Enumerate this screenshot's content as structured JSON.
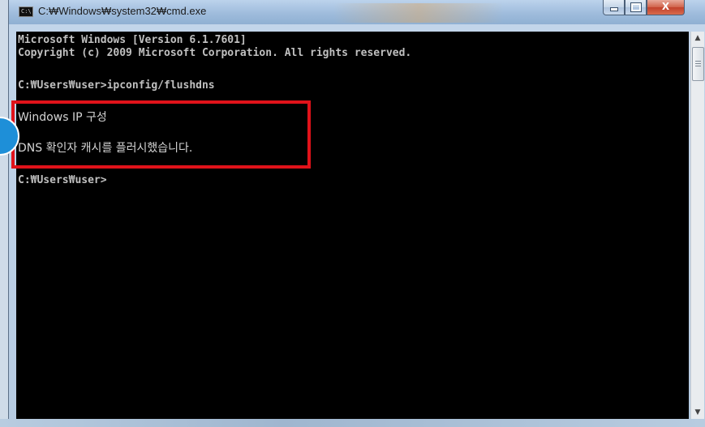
{
  "window": {
    "title": "C:₩Windows₩system32₩cmd.exe",
    "icon_label": "C:\\"
  },
  "controls": {
    "minimize_icon": "minimize-icon",
    "maximize_icon": "maximize-icon",
    "close_label": "X"
  },
  "console": {
    "lines": [
      "Microsoft Windows [Version 6.1.7601]",
      "Copyright (c) 2009 Microsoft Corporation. All rights reserved.",
      "C:₩Users₩user>ipconfig/flushdns",
      "Windows IP 구성",
      "DNS 확인자 캐시를 플러시했습니다.",
      "C:₩Users₩user>"
    ]
  },
  "scrollbar": {
    "up_arrow": "▲",
    "down_arrow": "▼"
  },
  "colors": {
    "console_bg": "#000000",
    "console_text": "#c0c0c0",
    "highlight": "#e0121a",
    "close_button": "#c2412b"
  }
}
